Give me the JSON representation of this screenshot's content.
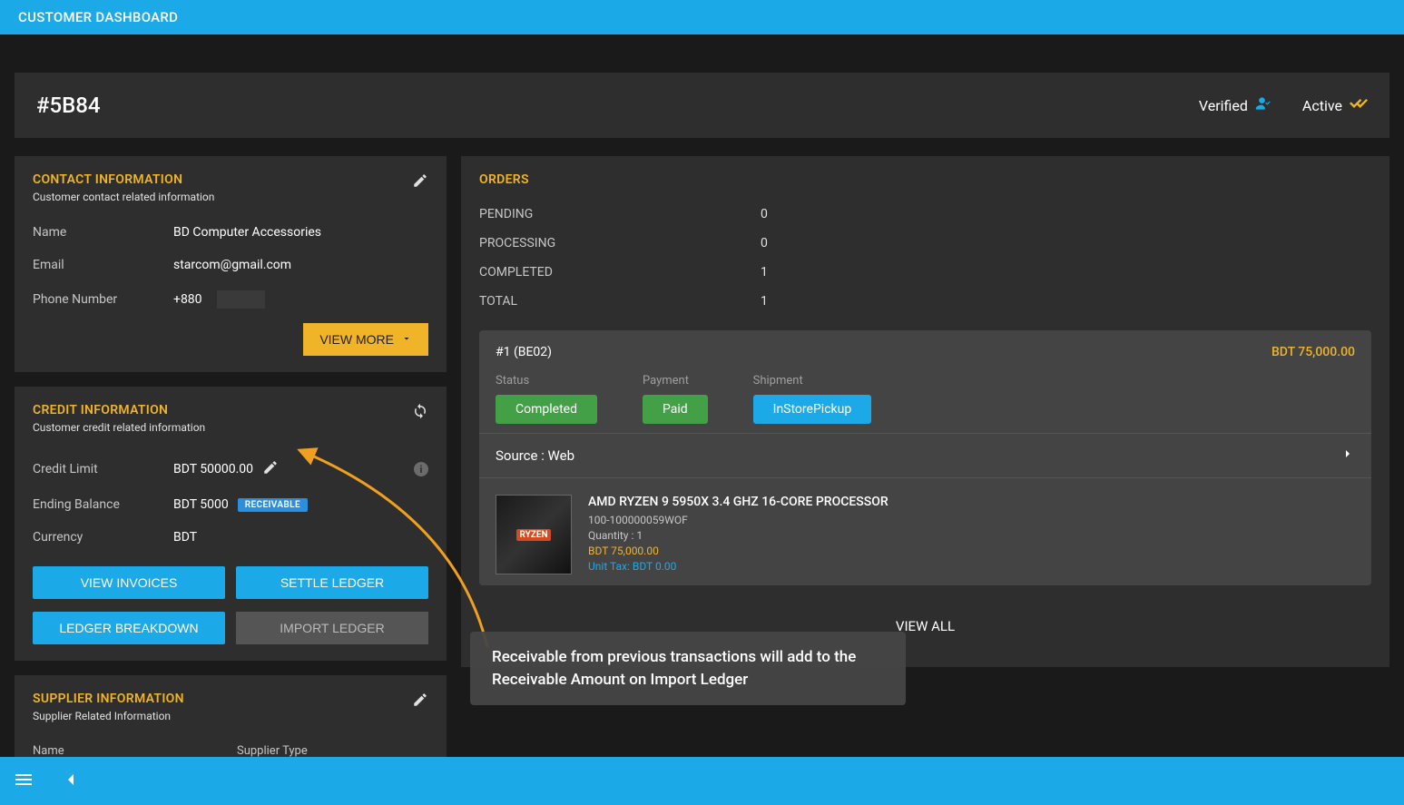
{
  "header": {
    "title": "CUSTOMER DASHBOARD",
    "customer_id": "#5B84",
    "status_verified": "Verified",
    "status_active": "Active"
  },
  "contact": {
    "title": "CONTACT INFORMATION",
    "subtitle": "Customer contact related information",
    "name_label": "Name",
    "name_value": "BD Computer Accessories",
    "email_label": "Email",
    "email_value": "starcom@gmail.com",
    "phone_label": "Phone Number",
    "phone_value": "+880",
    "view_more": "VIEW MORE"
  },
  "credit": {
    "title": "CREDIT INFORMATION",
    "subtitle": "Customer credit related information",
    "limit_label": "Credit Limit",
    "limit_value": "BDT 50000.00",
    "balance_label": "Ending Balance",
    "balance_value": "BDT 5000",
    "balance_badge": "RECEIVABLE",
    "currency_label": "Currency",
    "currency_value": "BDT",
    "btn_view_invoices": "VIEW INVOICES",
    "btn_settle_ledger": "SETTLE LEDGER",
    "btn_ledger_breakdown": "LEDGER BREAKDOWN",
    "btn_import_ledger": "IMPORT LEDGER"
  },
  "supplier": {
    "title": "SUPPLIER INFORMATION",
    "subtitle": "Supplier Related Information",
    "col_name": "Name",
    "col_type": "Supplier Type"
  },
  "orders": {
    "title": "ORDERS",
    "summary": {
      "pending_label": "PENDING",
      "pending_value": "0",
      "processing_label": "PROCESSING",
      "processing_value": "0",
      "completed_label": "COMPLETED",
      "completed_value": "1",
      "total_label": "TOTAL",
      "total_value": "1"
    },
    "order": {
      "id": "#1 (BE02)",
      "amount": "BDT 75,000.00",
      "status_label": "Status",
      "status_value": "Completed",
      "payment_label": "Payment",
      "payment_value": "Paid",
      "shipment_label": "Shipment",
      "shipment_value": "InStorePickup",
      "source": "Source : Web",
      "product": {
        "name": "AMD RYZEN 9 5950X 3.4 GHZ 16-CORE PROCESSOR",
        "sku": "100-100000059WOF",
        "qty": "Quantity : 1",
        "price": "BDT 75,000.00",
        "tax": "Unit Tax: BDT 0.00"
      }
    },
    "view_all": "VIEW ALL"
  },
  "annotation": {
    "text": "Receivable from previous transactions will add to the Receivable Amount on Import Ledger"
  }
}
